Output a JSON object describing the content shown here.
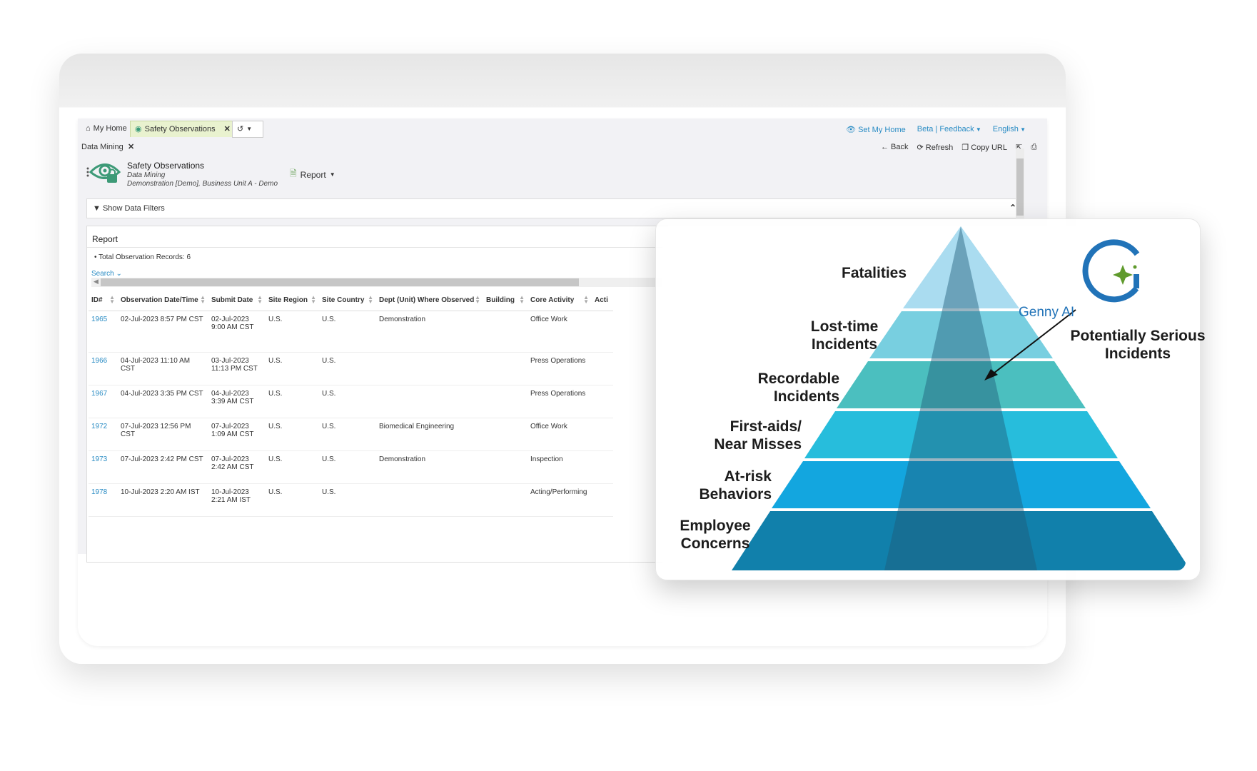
{
  "tabs": {
    "home": "My Home",
    "active": "Safety Observations"
  },
  "top_links": {
    "set_home": "Set My Home",
    "beta": "Beta | Feedback",
    "lang": "English"
  },
  "secondary": {
    "data_mining": "Data Mining"
  },
  "actions": {
    "back": "Back",
    "refresh": "Refresh",
    "copy_url": "Copy URL"
  },
  "title_block": {
    "title": "Safety Observations",
    "sub": "Data Mining",
    "sub2": "Demonstration [Demo], Business Unit A - Demo"
  },
  "report_button": "Report",
  "filters": {
    "label": "Show Data Filters"
  },
  "report": {
    "title": "Report",
    "total": "• Total Observation Records: 6",
    "search": "Search"
  },
  "table": {
    "columns": [
      "ID#",
      "Observation Date/Time",
      "Submit Date",
      "Site Region",
      "Site Country",
      "Dept (Unit) Where Observed",
      "Building",
      "Core Activity",
      "Acti"
    ],
    "rows": [
      [
        "1965",
        "02-Jul-2023 8:57 PM CST",
        "02-Jul-2023 9:00 AM CST",
        "U.S.",
        "U.S.",
        "Demonstration",
        "",
        "Office Work"
      ],
      [
        "1966",
        "04-Jul-2023 11:10 AM CST",
        "03-Jul-2023 11:13 PM CST",
        "U.S.",
        "U.S.",
        "",
        "",
        "Press Operations"
      ],
      [
        "1967",
        "04-Jul-2023 3:35 PM CST",
        "04-Jul-2023 3:39 AM CST",
        "U.S.",
        "U.S.",
        "",
        "",
        "Press Operations"
      ],
      [
        "1972",
        "07-Jul-2023 12:56 PM CST",
        "07-Jul-2023 1:09 AM CST",
        "U.S.",
        "U.S.",
        "Biomedical Engineering",
        "",
        "Office Work"
      ],
      [
        "1973",
        "07-Jul-2023 2:42 PM CST",
        "07-Jul-2023 2:42 AM CST",
        "U.S.",
        "U.S.",
        "Demonstration",
        "",
        "Inspection"
      ],
      [
        "1978",
        "10-Jul-2023 2:20 AM IST",
        "10-Jul-2023 2:21 AM IST",
        "U.S.",
        "U.S.",
        "",
        "",
        "Acting/Performing"
      ]
    ]
  },
  "pyramid": {
    "levels": [
      {
        "label": "Fatalities",
        "color": "#aadcf0"
      },
      {
        "label": "Lost-time Incidents",
        "color": "#78cfe0"
      },
      {
        "label": "Recordable Incidents",
        "color": "#4bbfbf"
      },
      {
        "label": "First-aids/ Near Misses",
        "color": "#27bddc"
      },
      {
        "label": "At-risk Behaviors",
        "color": "#13a6df"
      },
      {
        "label": "Employee Concerns",
        "color": "#1180ab"
      }
    ],
    "center_color": "#1f5b77",
    "genny_label": "Genny AI",
    "genny_color": "#2173b8",
    "genny_sparkle_color": "#5f9a2c",
    "callout": "Potentially Serious Incidents"
  }
}
